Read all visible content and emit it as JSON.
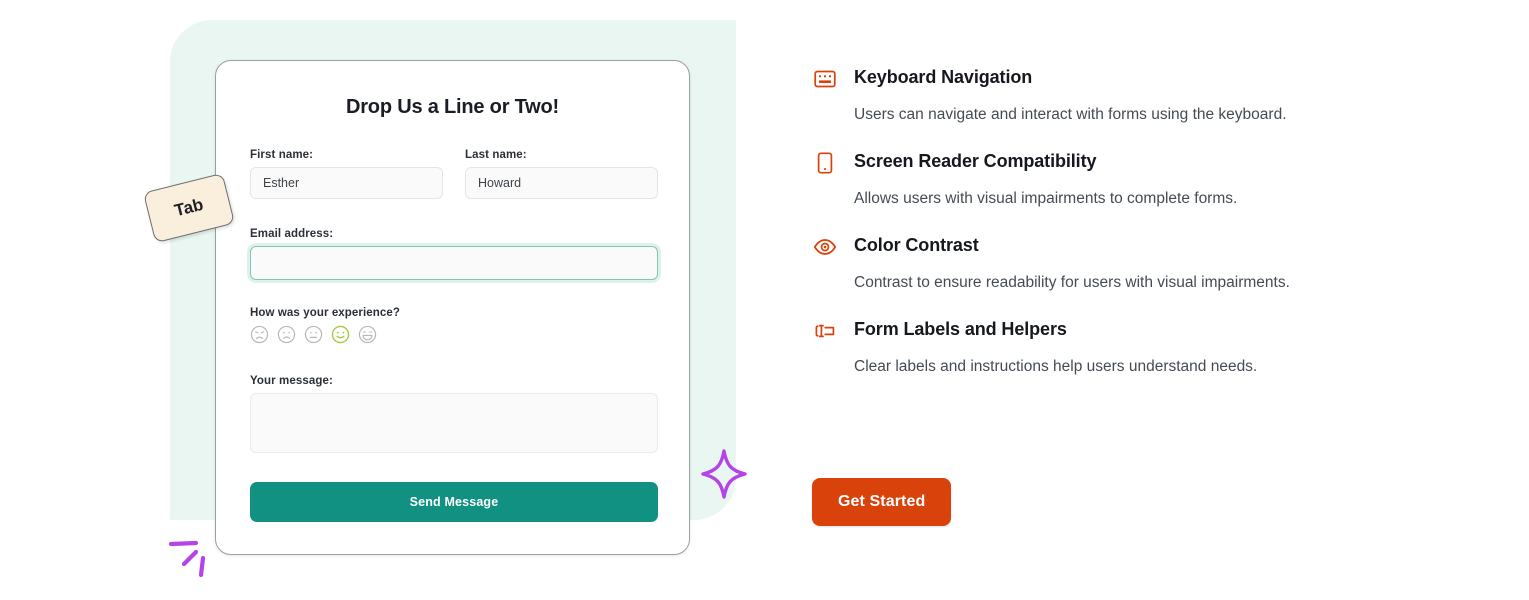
{
  "form": {
    "title": "Drop Us a Line or Two!",
    "first_name": {
      "label": "First name:",
      "value": "Esther"
    },
    "last_name": {
      "label": "Last name:",
      "value": "Howard"
    },
    "email": {
      "label": "Email address:",
      "value": "",
      "placeholder": ""
    },
    "rating": {
      "label": "How was your experience?",
      "options": [
        "angry-face-icon",
        "sad-face-icon",
        "neutral-face-icon",
        "smiling-face-icon",
        "grinning-face-icon"
      ],
      "selected_index": 3,
      "selected_color": "#9ccb3b",
      "unselected_color": "#b4b8bb"
    },
    "message": {
      "label": "Your message:",
      "value": "",
      "placeholder": ""
    },
    "submit_label": "Send Message",
    "submit_color": "#109181"
  },
  "decorations": {
    "tab_key_label": "Tab",
    "tab_key_color": "#faeedd",
    "sparkle_color": "#b544e8",
    "doodle_color": "#b544e8",
    "panel_color": "#e9f6f1"
  },
  "features": [
    {
      "icon": "keyboard-icon",
      "title": "Keyboard Navigation",
      "description": "Users can navigate and interact with forms using the keyboard."
    },
    {
      "icon": "screen-reader-icon",
      "title": "Screen Reader Compatibility",
      "description": "Allows users with visual impairments to complete forms."
    },
    {
      "icon": "eye-icon",
      "title": "Color Contrast",
      "description": "Contrast to ensure readability for users with visual impairments."
    },
    {
      "icon": "form-label-icon",
      "title": "Form Labels and Helpers",
      "description": "Clear labels and instructions help users understand needs."
    }
  ],
  "cta": {
    "label": "Get Started",
    "color": "#d9420b"
  }
}
